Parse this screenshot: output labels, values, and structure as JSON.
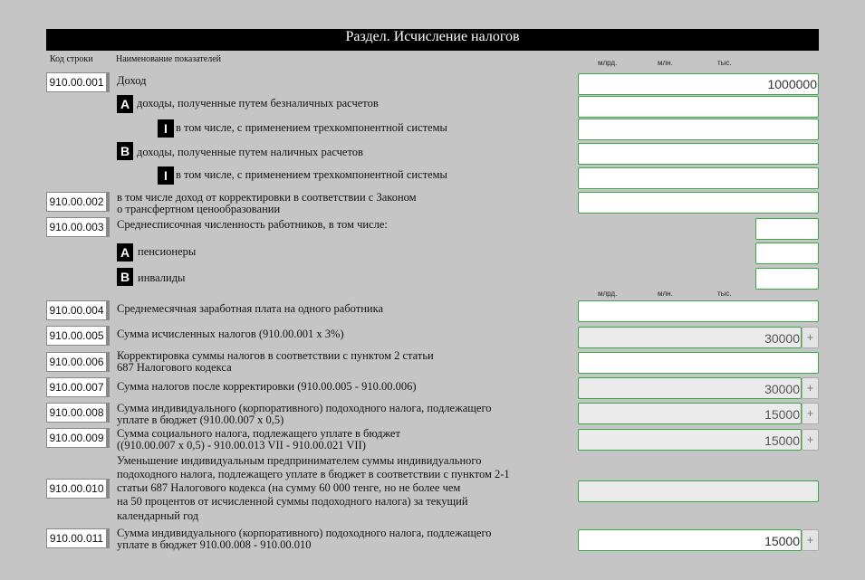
{
  "header": {
    "title": "Раздел. Исчисление налогов"
  },
  "columns": {
    "code": "Код строки",
    "name": "Наименование показателей"
  },
  "units": {
    "bln": "млрд.",
    "mln": "млн.",
    "ths": "тыс."
  },
  "add_button": "+",
  "rows": [
    {
      "code": "910.00.001",
      "label": "Доход",
      "value": "1000000"
    },
    {
      "badge": "A",
      "label": "доходы, полученные путем безналичных расчетов",
      "value": ""
    },
    {
      "badge": "I",
      "label": "в том числе, с применением трехкомпонентной системы",
      "value": ""
    },
    {
      "badge": "B",
      "label": "доходы, полученные путем наличных расчетов",
      "value": ""
    },
    {
      "badge": "I",
      "label": "в том числе, с применением трехкомпонентной системы",
      "value": ""
    },
    {
      "code": "910.00.002",
      "label_lines": [
        "в том числе доход от корректировки в соответствии с Законом",
        "о трансфертном ценообразовании"
      ],
      "value": ""
    },
    {
      "code": "910.00.003",
      "label": "Среднесписочная численность работников, в том числе:",
      "value": ""
    },
    {
      "badge": "A",
      "label": "пенсионеры",
      "value": ""
    },
    {
      "badge": "B",
      "label": "инвалиды",
      "value": ""
    },
    {
      "code": "910.00.004",
      "label": "Среднемесячная заработная плата на одного работника",
      "value": ""
    },
    {
      "code": "910.00.005",
      "label": "Сумма исчисленных налогов (910.00.001 x 3%)",
      "value": "30000"
    },
    {
      "code": "910.00.006",
      "label_lines": [
        "Корректировка суммы налогов в соответствии с пунктом 2 статьи",
        "687 Налогового кодекса"
      ],
      "value": ""
    },
    {
      "code": "910.00.007",
      "label": "Сумма налогов после корректировки (910.00.005 - 910.00.006)",
      "value": "30000"
    },
    {
      "code": "910.00.008",
      "label_lines": [
        "Сумма индивидуального (корпоративного) подоходного налога, подлежащего",
        "уплате в бюджет (910.00.007 x 0,5)"
      ],
      "value": "15000"
    },
    {
      "code": "910.00.009",
      "label_lines": [
        "Сумма социального налога, подлежащего уплате в бюджет",
        "((910.00.007 x 0,5) - 910.00.013 VII - 910.00.021 VII)"
      ],
      "value": "15000"
    },
    {
      "code": "910.00.010",
      "label_lines": [
        "Уменьшение индивидуальным предпринимателем суммы индивидуального",
        "подоходного налога, подлежащего уплате в бюджет в соответствии с пунктом 2-1",
        "статьи 687 Налогового кодекса (на сумму 60 000 тенге, но не более чем",
        "на 50 процентов от исчисленной суммы подоходного налога) за текущий",
        "календарный год"
      ],
      "value": ""
    },
    {
      "code": "910.00.011",
      "label_lines": [
        "Сумма индивидуального (корпоративного) подоходного налога, подлежащего",
        "уплате в бюджет 910.00.008 - 910.00.010"
      ],
      "value": "15000"
    }
  ]
}
